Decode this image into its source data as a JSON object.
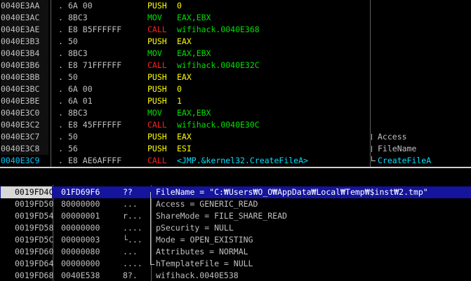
{
  "colors": {
    "push": "#ffff00",
    "mov": "#00e000",
    "call": "#ff2020",
    "call_target": "#00e000",
    "call_api_target": "#00e0ff",
    "selected_addr": "#00c8ff",
    "stack_highlight": "#14149c"
  },
  "disasm": {
    "rows": [
      {
        "addr": "0040E3AA",
        "sep": ".",
        "hex": "6A 00",
        "op": "PUSH",
        "opnd": "0",
        "kind": "push"
      },
      {
        "addr": "0040E3AC",
        "sep": ".",
        "hex": "8BC3",
        "op": "MOV",
        "opnd": "EAX,EBX",
        "kind": "mov"
      },
      {
        "addr": "0040E3AE",
        "sep": ".",
        "hex": "E8 B5FFFFFF",
        "op": "CALL",
        "opnd": "wifihack.0040E368",
        "kind": "call"
      },
      {
        "addr": "0040E3B3",
        "sep": ".",
        "hex": "50",
        "op": "PUSH",
        "opnd": "EAX",
        "kind": "push"
      },
      {
        "addr": "0040E3B4",
        "sep": ".",
        "hex": "8BC3",
        "op": "MOV",
        "opnd": "EAX,EBX",
        "kind": "mov"
      },
      {
        "addr": "0040E3B6",
        "sep": ".",
        "hex": "E8 71FFFFFF",
        "op": "CALL",
        "opnd": "wifihack.0040E32C",
        "kind": "call"
      },
      {
        "addr": "0040E3BB",
        "sep": ".",
        "hex": "50",
        "op": "PUSH",
        "opnd": "EAX",
        "kind": "push"
      },
      {
        "addr": "0040E3BC",
        "sep": ".",
        "hex": "6A 00",
        "op": "PUSH",
        "opnd": "0",
        "kind": "push"
      },
      {
        "addr": "0040E3BE",
        "sep": ".",
        "hex": "6A 01",
        "op": "PUSH",
        "opnd": "1",
        "kind": "push"
      },
      {
        "addr": "0040E3C0",
        "sep": ".",
        "hex": "8BC3",
        "op": "MOV",
        "opnd": "EAX,EBX",
        "kind": "mov"
      },
      {
        "addr": "0040E3C2",
        "sep": ".",
        "hex": "E8 45FFFFFF",
        "op": "CALL",
        "opnd": "wifihack.0040E30C",
        "kind": "call"
      },
      {
        "addr": "0040E3C7",
        "sep": ".",
        "hex": "50",
        "op": "PUSH",
        "opnd": "EAX",
        "kind": "push",
        "comment": "Access"
      },
      {
        "addr": "0040E3C8",
        "sep": ".",
        "hex": "56",
        "op": "PUSH",
        "opnd": "ESI",
        "kind": "push",
        "comment": "FileName"
      },
      {
        "addr": "0040E3C9",
        "sep": ".",
        "hex": "E8 AE6AFFFF",
        "op": "CALL",
        "opnd": "<JMP.&kernel32.CreateFileA>",
        "kind": "callapi",
        "comment": "CreateFileA",
        "selected": true
      }
    ]
  },
  "stack": {
    "rows": [
      {
        "addr": "0019FD4C",
        "val": "01FD69F6",
        "asc": "??",
        "cmt": "FileName = \"C:₩Users₩O_O₩AppData₩Local₩Temp₩$inst₩2.tmp\"",
        "selected": true
      },
      {
        "addr": "0019FD50",
        "val": "80000000",
        "asc": "...",
        "cmt": "Access = GENERIC_READ"
      },
      {
        "addr": "0019FD54",
        "val": "00000001",
        "asc": "r...",
        "cmt": "ShareMode = FILE_SHARE_READ"
      },
      {
        "addr": "0019FD58",
        "val": "00000000",
        "asc": "....",
        "cmt": "pSecurity = NULL"
      },
      {
        "addr": "0019FD5C",
        "val": "00000003",
        "asc": "└...",
        "cmt": "Mode = OPEN_EXISTING"
      },
      {
        "addr": "0019FD60",
        "val": "00000080",
        "asc": "...",
        "cmt": "Attributes = NORMAL"
      },
      {
        "addr": "0019FD64",
        "val": "00000000",
        "asc": "....",
        "cmt": "hTemplateFile = NULL"
      },
      {
        "addr": "0019FD68",
        "val": "0040E538",
        "asc": "8?.",
        "cmt": "wifihack.0040E538"
      }
    ]
  }
}
